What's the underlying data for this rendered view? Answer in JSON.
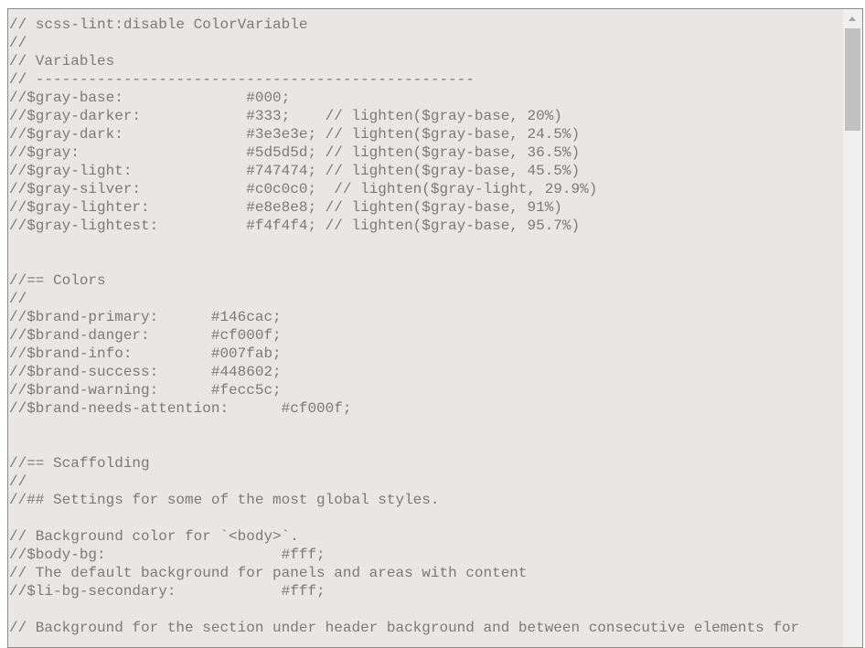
{
  "editor": {
    "lines": [
      "// scss-lint:disable ColorVariable",
      "//",
      "// Variables",
      "// --------------------------------------------------",
      "//$gray-base:              #000;",
      "//$gray-darker:            #333;    // lighten($gray-base, 20%)",
      "//$gray-dark:              #3e3e3e; // lighten($gray-base, 24.5%)",
      "//$gray:                   #5d5d5d; // lighten($gray-base, 36.5%)",
      "//$gray-light:             #747474; // lighten($gray-base, 45.5%)",
      "//$gray-silver:            #c0c0c0;  // lighten($gray-light, 29.9%)",
      "//$gray-lighter:           #e8e8e8; // lighten($gray-base, 91%)",
      "//$gray-lightest:          #f4f4f4; // lighten($gray-base, 95.7%)",
      "",
      "",
      "//== Colors",
      "//",
      "//$brand-primary:      #146cac;",
      "//$brand-danger:       #cf000f;",
      "//$brand-info:         #007fab;",
      "//$brand-success:      #448602;",
      "//$brand-warning:      #fecc5c;",
      "//$brand-needs-attention:      #cf000f;",
      "",
      "",
      "//== Scaffolding",
      "//",
      "//## Settings for some of the most global styles.",
      "",
      "// Background color for `<body>`.",
      "//$body-bg:                    #fff;",
      "// The default background for panels and areas with content",
      "//$li-bg-secondary:            #fff;",
      "",
      "// Background for the section under header background and between consecutive elements for"
    ]
  },
  "scrollbar": {
    "position_fraction": 0.0
  }
}
